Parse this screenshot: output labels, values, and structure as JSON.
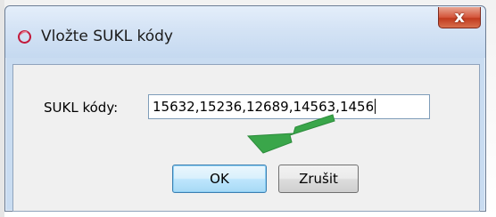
{
  "dialog": {
    "title": "Vložte SUKL kódy",
    "title_icon": "app-ring-icon",
    "close_label": "x"
  },
  "form": {
    "label": "SUKL kódy:",
    "value": "15632,15236,12689,14563,1456"
  },
  "buttons": {
    "ok": "OK",
    "cancel": "Zrušit"
  },
  "colors": {
    "title_bar": "#c9dcf1",
    "close_button": "#c9432a",
    "arrow": "#3aa64a"
  }
}
